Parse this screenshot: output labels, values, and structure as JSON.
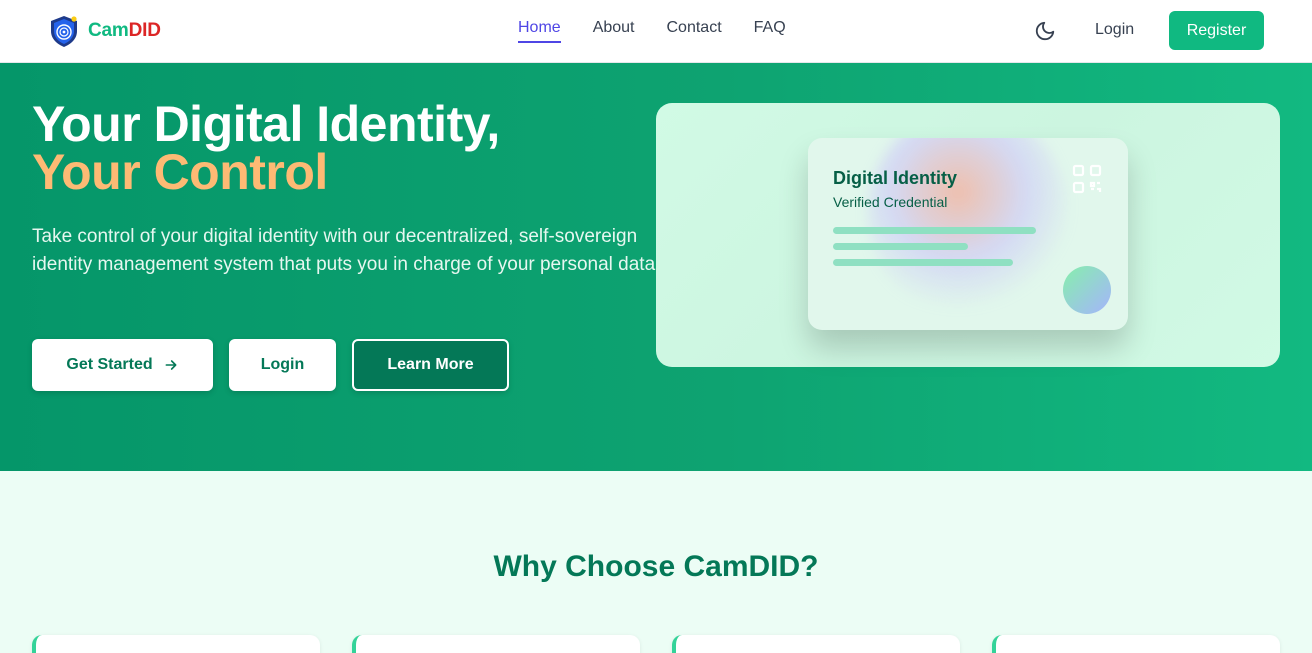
{
  "brand": {
    "name_part1": "Cam",
    "name_part2": "DID"
  },
  "nav": {
    "links": [
      {
        "label": "Home",
        "active": true
      },
      {
        "label": "About",
        "active": false
      },
      {
        "label": "Contact",
        "active": false
      },
      {
        "label": "FAQ",
        "active": false
      }
    ],
    "login_label": "Login",
    "register_label": "Register",
    "theme_icon": "moon-icon"
  },
  "hero": {
    "title_line1": "Your Digital Identity,",
    "title_line2": "Your Control",
    "description": "Take control of your digital identity with our decentralized, self-sovereign identity management system that puts you in charge of your personal data.",
    "buttons": {
      "get_started": "Get Started",
      "login": "Login",
      "learn_more": "Learn More"
    },
    "card": {
      "title": "Digital Identity",
      "subtitle": "Verified Credential",
      "qr_icon": "qr-code-icon"
    }
  },
  "features": {
    "title": "Why Choose CamDID?",
    "card_count_visible": 4
  },
  "colors": {
    "accent": "#10b981",
    "brand_red": "#dc2626",
    "nav_active": "#4f46e5",
    "hero_highlight": "#fdba74",
    "section_title": "#047857"
  }
}
